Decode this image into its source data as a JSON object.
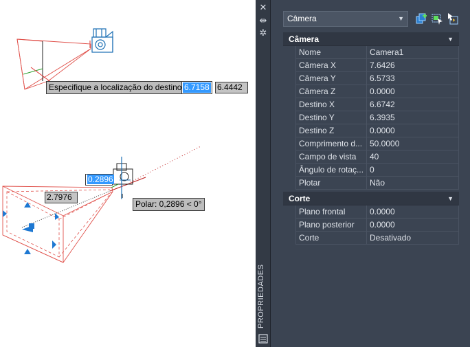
{
  "drawing": {
    "top_prompt": "Especifique a localização do destino:",
    "top_input_x": "6.7158",
    "top_input_y": "6.4442",
    "bottom_input": "0.2896",
    "distance_input": "2.7976",
    "polar_tip": "Polar: 0,2896 < 0°"
  },
  "palette": {
    "title": "PROPRIEDADES",
    "selector": "Câmera",
    "categories": [
      {
        "label": "Câmera",
        "rows": [
          {
            "name": "Nome",
            "value": "Camera1"
          },
          {
            "name": "Câmera X",
            "value": "7.6426"
          },
          {
            "name": "Câmera Y",
            "value": "6.5733"
          },
          {
            "name": "Câmera Z",
            "value": "0.0000"
          },
          {
            "name": "Destino X",
            "value": "6.6742"
          },
          {
            "name": "Destino Y",
            "value": "6.3935"
          },
          {
            "name": "Destino Z",
            "value": "0.0000"
          },
          {
            "name": "Comprimento  d...",
            "value": "50.0000"
          },
          {
            "name": "Campo de vista",
            "value": "40"
          },
          {
            "name": "Ângulo de rotaç...",
            "value": "0"
          },
          {
            "name": "Plotar",
            "value": "Não"
          }
        ]
      },
      {
        "label": "Corte",
        "rows": [
          {
            "name": "Plano frontal",
            "value": "0.0000"
          },
          {
            "name": "Plano posterior",
            "value": "0.0000"
          },
          {
            "name": "Corte",
            "value": "Desativado"
          }
        ]
      }
    ],
    "icons": [
      "close-icon",
      "auto-hide-icon",
      "settings-icon",
      "quick-select-icon",
      "select-objects-icon",
      "toggle-pickadd-icon",
      "properties-panel-icon"
    ],
    "colors": {
      "panel_bg": "#3b4452",
      "strip_bg": "#333a45",
      "category_bg": "#303743",
      "selection_blue": "#3399ff",
      "wire_red": "#e0504a",
      "grip_blue": "#1e78d2"
    }
  }
}
